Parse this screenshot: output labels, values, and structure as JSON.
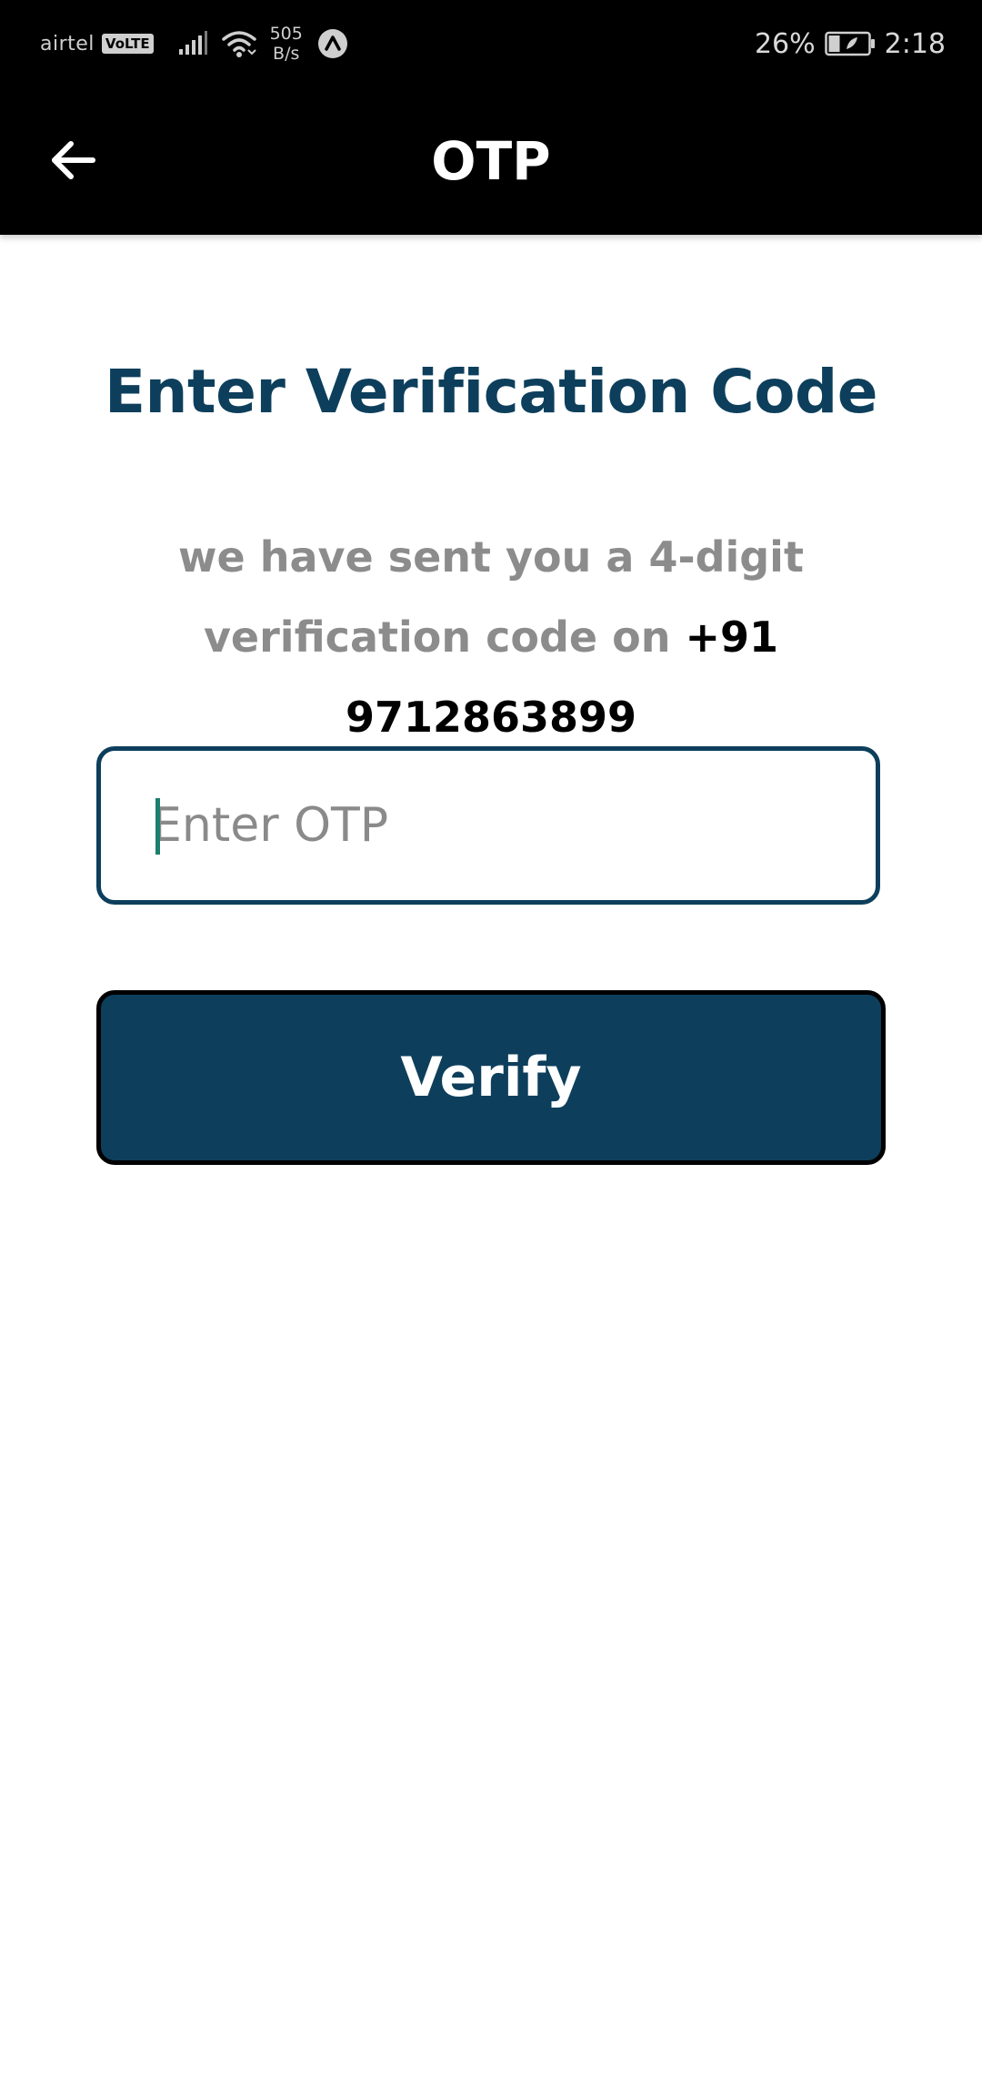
{
  "status_bar": {
    "carrier": "airtel",
    "volte_label": "VoLTE",
    "net_speed_value": "505",
    "net_speed_unit": "B/s",
    "battery_percent": "26%",
    "time": "2:18",
    "icons": [
      "signal-icon",
      "wifi-icon",
      "notification-a-icon",
      "battery-charging-icon"
    ]
  },
  "app_bar": {
    "title": "OTP",
    "back_icon": "arrow-left-icon"
  },
  "content": {
    "heading": "Enter Verification Code",
    "subtext_prefix": "we have sent you a 4-digit verification code on",
    "phone_number": "+91 9712863899",
    "otp_input": {
      "placeholder": "Enter OTP",
      "value": ""
    },
    "verify_button_label": "Verify"
  },
  "colors": {
    "primary": "#0d3f5c",
    "subtext": "#8c8c8c",
    "caret": "#1a7f6d",
    "app_bar": "#000000"
  }
}
